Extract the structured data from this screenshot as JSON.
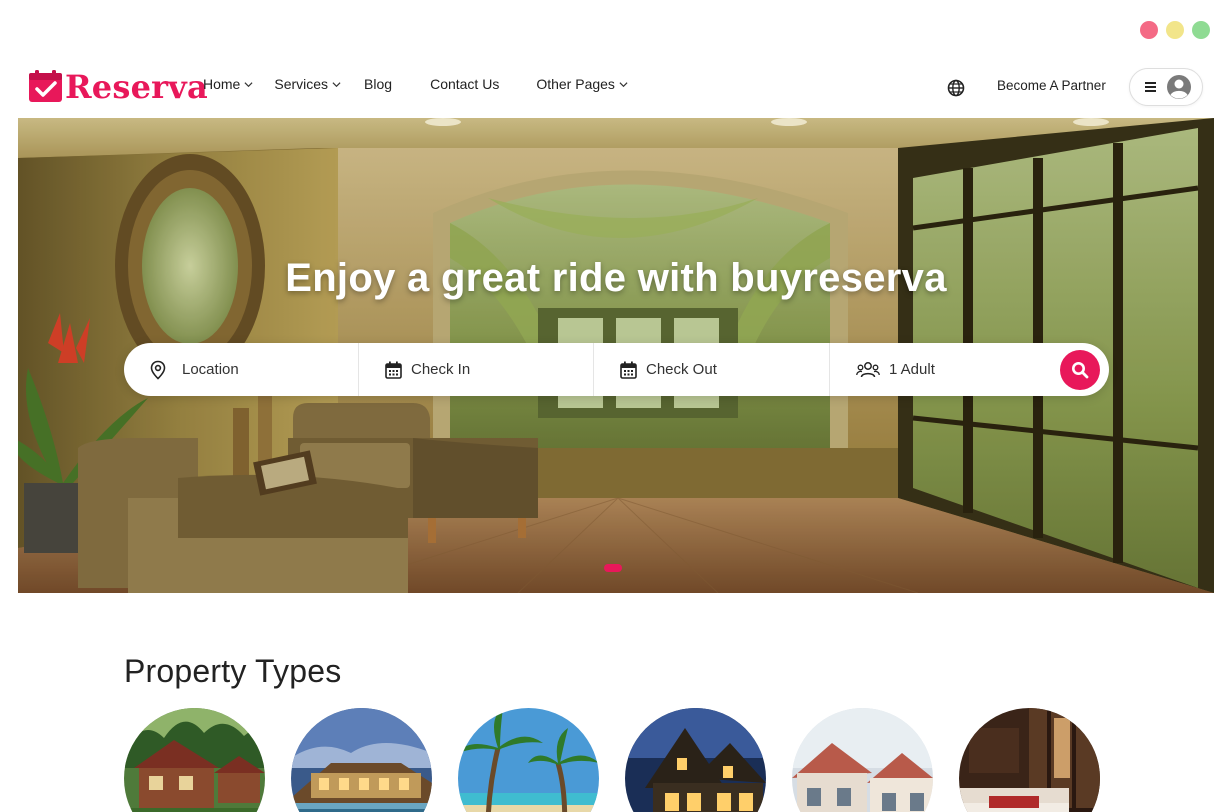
{
  "window_controls": {
    "colors": [
      "#f46a85",
      "#f2e58a",
      "#8fdb93"
    ]
  },
  "brand": {
    "name": "Reserva",
    "accent": "#e8185a"
  },
  "nav": {
    "items": [
      {
        "label": "Home",
        "has_dropdown": true
      },
      {
        "label": "Services",
        "has_dropdown": true
      },
      {
        "label": "Blog",
        "has_dropdown": false
      },
      {
        "label": "Contact Us",
        "has_dropdown": false
      },
      {
        "label": "Other Pages",
        "has_dropdown": true
      }
    ],
    "language_icon": "globe-icon",
    "partner_label": "Become A Partner",
    "menu_icon": "hamburger-icon",
    "avatar_icon": "user-avatar-icon"
  },
  "hero": {
    "title": "Enjoy a great ride with buyreserva",
    "slider_active_index": 0
  },
  "search": {
    "location": {
      "placeholder": "Location",
      "icon": "map-pin-icon"
    },
    "check_in": {
      "label": "Check In",
      "icon": "calendar-icon"
    },
    "check_out": {
      "label": "Check Out",
      "icon": "calendar-icon"
    },
    "guests": {
      "label": "1 Adult",
      "icon": "users-icon"
    },
    "button_icon": "search-icon"
  },
  "property_types": {
    "title": "Property Types",
    "items": [
      {
        "image": "wooden-cabin-photo"
      },
      {
        "image": "resort-pool-photo"
      },
      {
        "image": "palm-beach-photo"
      },
      {
        "image": "villa-night-photo"
      },
      {
        "image": "townhouse-photo"
      },
      {
        "image": "hotel-room-photo"
      }
    ]
  }
}
